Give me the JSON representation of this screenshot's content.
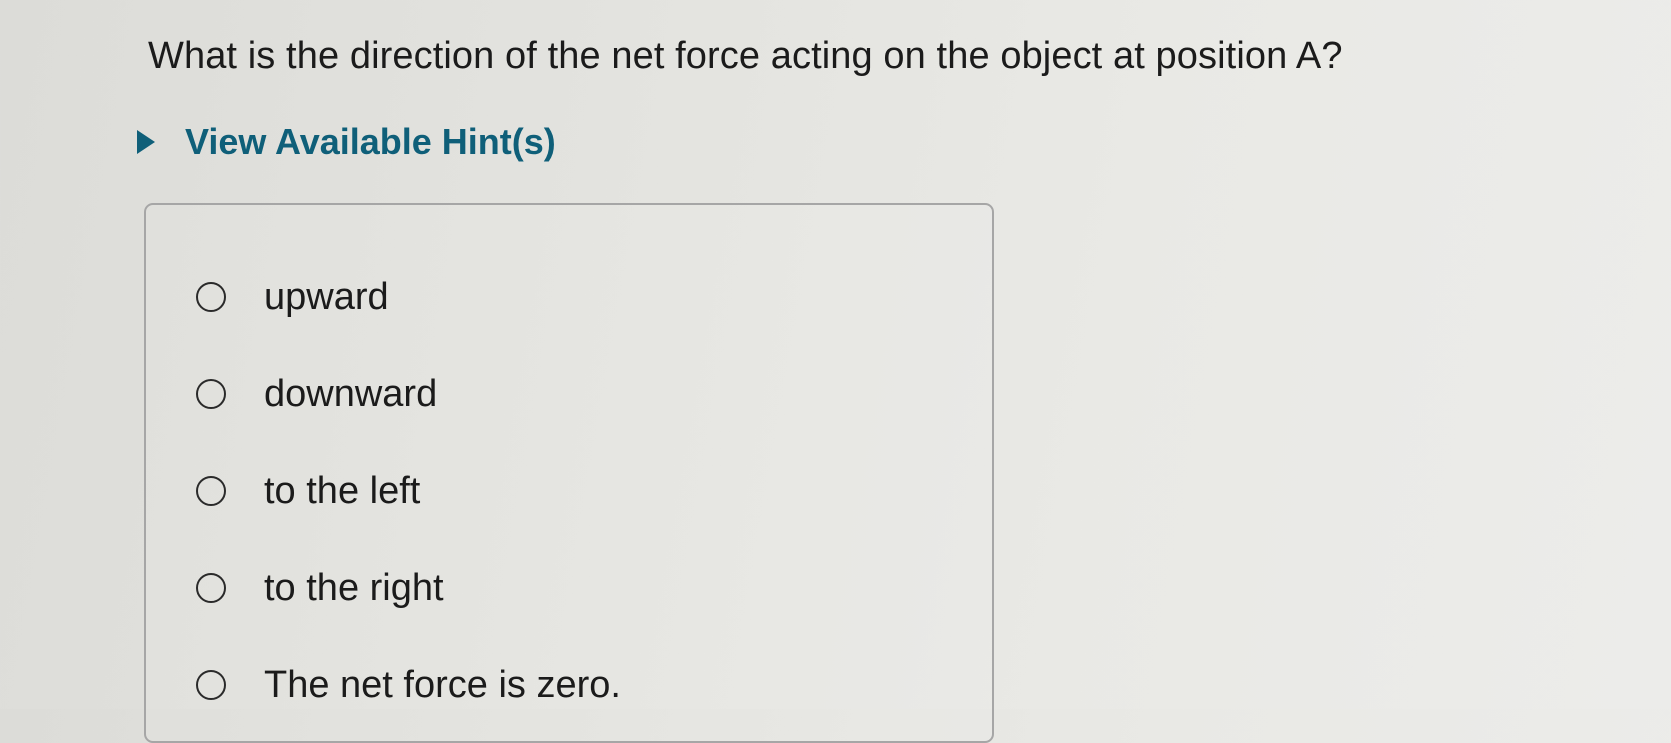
{
  "question": {
    "text": "What is the direction of the net force acting on the object at position A?"
  },
  "hints": {
    "label": "View Available Hint(s)",
    "icon": "triangle-right-icon",
    "color": "#0f5f79"
  },
  "options": [
    {
      "label": "upward",
      "selected": false
    },
    {
      "label": "downward",
      "selected": false
    },
    {
      "label": "to the left",
      "selected": false
    },
    {
      "label": "to the right",
      "selected": false
    },
    {
      "label": "The net force is zero.",
      "selected": false
    }
  ]
}
